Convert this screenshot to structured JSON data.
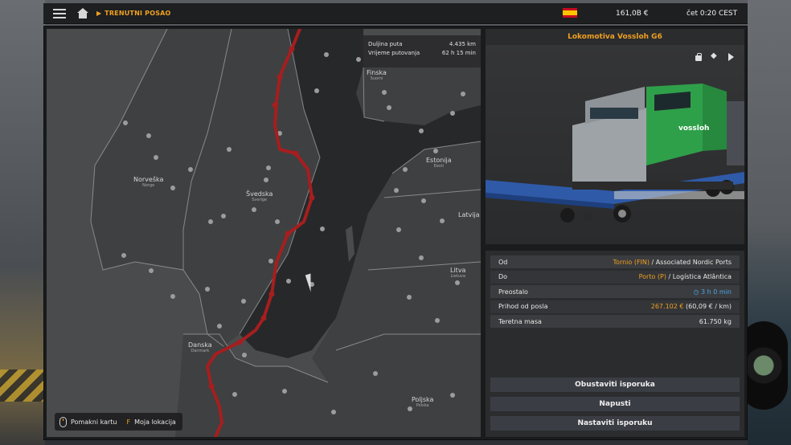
{
  "topbar": {
    "breadcrumb": "TRENUTNI POSAO",
    "money": "161,0B  €",
    "time": "čet 0:20 CEST",
    "flag": "spain-flag"
  },
  "map": {
    "route_info": {
      "distance_label": "Duljina puta",
      "distance_value": "4.435 km",
      "travel_label": "Vrijeme putovanja",
      "travel_value": "62 h 15 min"
    },
    "labels": [
      {
        "name": "Finska",
        "sub": "Suomi"
      },
      {
        "name": "Norveška",
        "sub": "Norge"
      },
      {
        "name": "Švedska",
        "sub": "Sverige"
      },
      {
        "name": "Estonija",
        "sub": "Eesti"
      },
      {
        "name": "Latvija",
        "sub": ""
      },
      {
        "name": "Litva",
        "sub": "Lietuva"
      },
      {
        "name": "Danska",
        "sub": "Danmark"
      },
      {
        "name": "Poljska",
        "sub": "Polska"
      }
    ],
    "hint_move": "Pomakni kartu",
    "hint_key": "F",
    "hint_location": "Moja lokacija",
    "route_color": "#a61e1e"
  },
  "cargo": {
    "title": "Lokomotiva Vossloh G6",
    "locomotive_text": "vossloh"
  },
  "details": {
    "from_label": "Od",
    "from_city": "Tornio (FIN)",
    "from_company": " / Associated Nordic Ports",
    "to_label": "Do",
    "to_city": "Porto (P)",
    "to_company": " / Logística Atlântica",
    "remaining_label": "Preostalo",
    "remaining_value": "3 h 0 min",
    "income_label": "Prihod od posla",
    "income_value": "267.102 €",
    "income_rate": " (60,09 € / km)",
    "mass_label": "Teretna masa",
    "mass_value": "61.750 kg"
  },
  "buttons": {
    "cancel": "Obustaviti isporuka",
    "quit": "Napusti",
    "continue": "Nastaviti isporuku"
  },
  "colors": {
    "accent": "#f0a020",
    "panel": "#2b2c2e"
  }
}
